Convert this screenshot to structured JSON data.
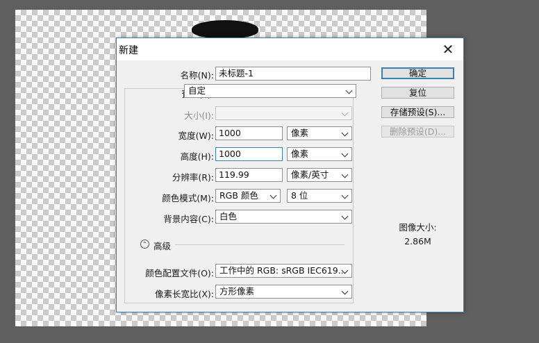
{
  "dialog": {
    "title": "新建",
    "close_glyph": "✕",
    "name": {
      "label": "名称(N):",
      "value": "未标题-1"
    },
    "preset": {
      "label": "预设(P):",
      "value": "自定"
    },
    "size": {
      "label": "大小(I):",
      "value": ""
    },
    "width": {
      "label": "宽度(W):",
      "value": "1000",
      "unit": "像素"
    },
    "height": {
      "label": "高度(H):",
      "value": "1000",
      "unit": "像素"
    },
    "resolution": {
      "label": "分辨率(R):",
      "value": "119.99",
      "unit": "像素/英寸"
    },
    "color_mode": {
      "label": "颜色模式(M):",
      "value": "RGB 颜色",
      "bits": "8 位"
    },
    "background": {
      "label": "背景内容(C):",
      "value": "白色"
    },
    "advanced": {
      "label": "高级",
      "icon": "chevron-up-circle-icon"
    },
    "color_profile": {
      "label": "颜色配置文件(O):",
      "value": "工作中的 RGB: sRGB IEC619..."
    },
    "pixel_aspect": {
      "label": "像素长宽比(X):",
      "value": "方形像素"
    },
    "buttons": {
      "ok": "确定",
      "reset": "复位",
      "save_preset": "存储预设(S)...",
      "delete_preset": "删除预设(D)..."
    },
    "image_size": {
      "label": "图像大小:",
      "value": "2.86M"
    }
  },
  "colors": {
    "workspace": "#5f5f5f",
    "dialog_bg": "#f0f0f0",
    "accent": "#3c7fb1"
  }
}
